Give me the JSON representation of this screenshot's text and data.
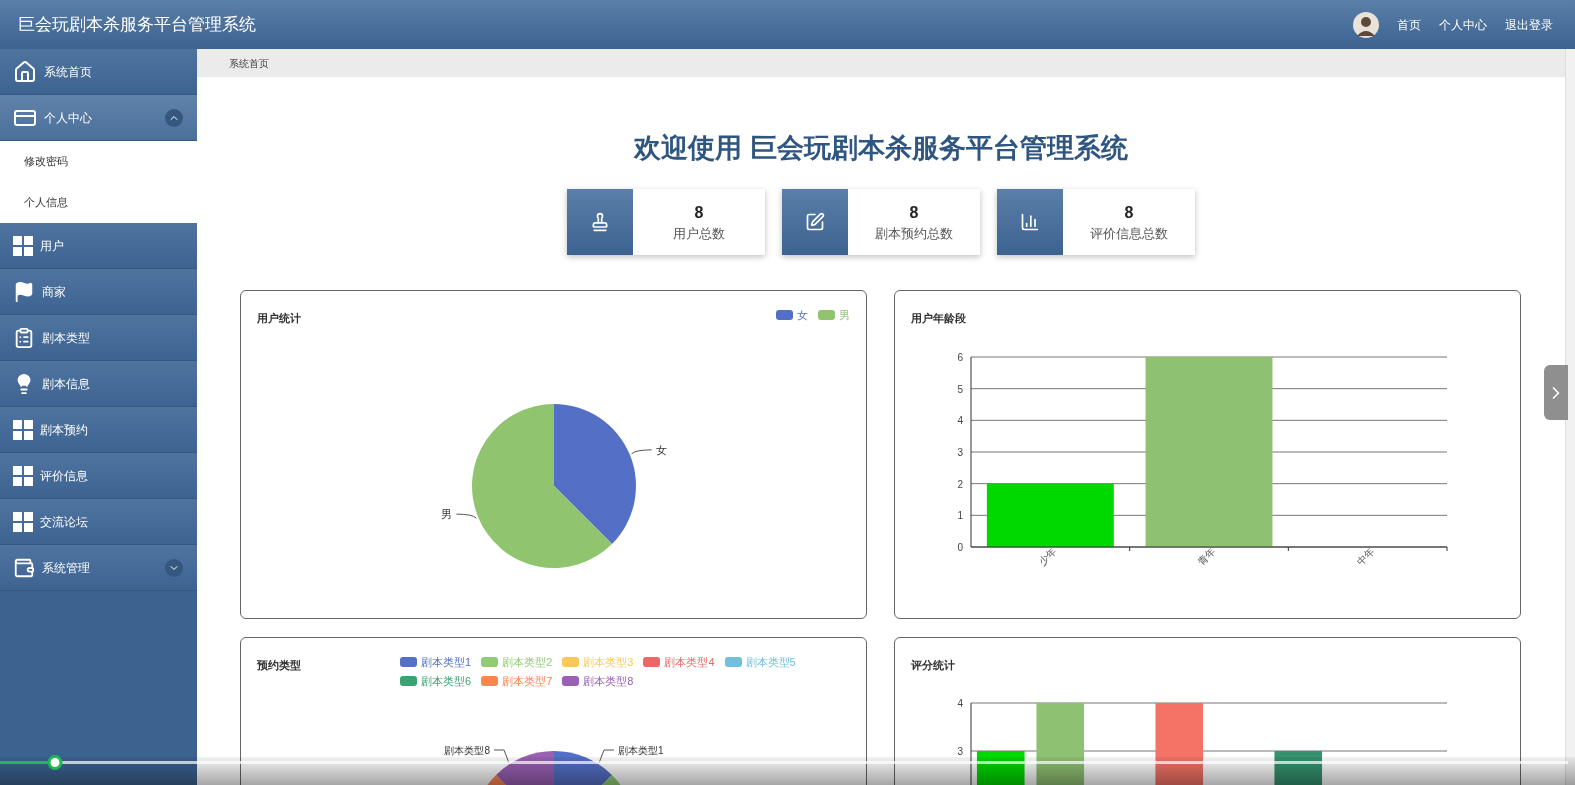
{
  "header": {
    "title": "巨会玩剧本杀服务平台管理系统",
    "nav": [
      "首页",
      "个人中心",
      "退出登录"
    ]
  },
  "sidebar": {
    "items": [
      {
        "kind": "link",
        "label": "系统首页"
      },
      {
        "kind": "group",
        "label": "个人中心",
        "expanded": true,
        "children": [
          {
            "label": "修改密码"
          },
          {
            "label": "个人信息"
          }
        ]
      },
      {
        "kind": "link",
        "label": "用户"
      },
      {
        "kind": "link",
        "label": "商家"
      },
      {
        "kind": "link",
        "label": "剧本类型"
      },
      {
        "kind": "link",
        "label": "剧本信息"
      },
      {
        "kind": "link",
        "label": "剧本预约"
      },
      {
        "kind": "link",
        "label": "评价信息"
      },
      {
        "kind": "link",
        "label": "交流论坛"
      },
      {
        "kind": "group",
        "label": "系统管理",
        "expanded": false
      }
    ]
  },
  "breadcrumb": "系统首页",
  "welcome": "欢迎使用 巨会玩剧本杀服务平台管理系统",
  "stats": [
    {
      "value": "8",
      "label": "用户总数"
    },
    {
      "value": "8",
      "label": "剧本预约总数"
    },
    {
      "value": "8",
      "label": "评价信息总数"
    }
  ],
  "charts": [
    {
      "kind": "chart",
      "title": "用户统计",
      "legend": [
        {
          "label": "女",
          "color": "#5470c6"
        },
        {
          "label": "男",
          "color": "#91c46f"
        }
      ],
      "chart_data": {
        "type": "pie",
        "categories": [
          "女",
          "男"
        ],
        "values": [
          37.5,
          62.5
        ]
      }
    },
    {
      "kind": "chart",
      "title": "用户年龄段",
      "chart_data": {
        "type": "bar",
        "categories": [
          "少年",
          "青年",
          "中年"
        ],
        "values": [
          2,
          6,
          0
        ],
        "ylim": [
          0,
          6
        ],
        "yticks": [
          0,
          1,
          2,
          3,
          4,
          5,
          6
        ],
        "grid": true
      }
    },
    {
      "kind": "pie_drawing",
      "title": "预约类型",
      "legend": [
        {
          "label": "剧本类型1",
          "color": "#5470c6"
        },
        {
          "label": "剧本类型2",
          "color": "#91cc75"
        },
        {
          "label": "剧本类型3",
          "color": "#fac858"
        },
        {
          "label": "剧本类型4",
          "color": "#ee6666"
        },
        {
          "label": "剧本类型5",
          "color": "#73c0de"
        },
        {
          "label": "剧本类型6",
          "color": "#3ba272"
        },
        {
          "label": "剧本类型7",
          "color": "#fc8452"
        },
        {
          "label": "剧本类型8",
          "color": "#9a60b4"
        }
      ],
      "slice_labels": [
        "剧本类型8",
        "剧本类型1"
      ]
    },
    {
      "kind": "bar_drawing",
      "title": "评分统计",
      "axis_labels": [
        "4",
        "3"
      ]
    }
  ],
  "video_progress": {
    "level": 0.035
  }
}
